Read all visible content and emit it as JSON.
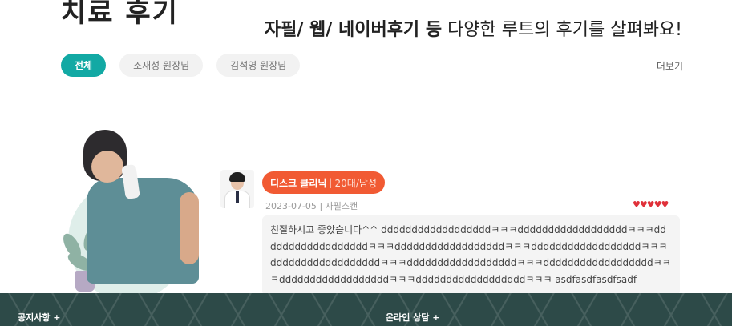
{
  "header": {
    "heading": "치료 후기",
    "subtitle_bold": "자필/ 웹/ 네이버후기 등",
    "subtitle_rest": " 다양한 루트의 후기를 살펴봐요!"
  },
  "tabs": [
    {
      "label": "전체",
      "active": true
    },
    {
      "label": "조재성 원장님",
      "active": false
    },
    {
      "label": "김석영 원장님",
      "active": false
    }
  ],
  "more_label": "더보기",
  "review": {
    "clinic": "디스크 클리닉",
    "separator": "|",
    "patient_meta": "20대/남성",
    "date": "2023-07-05",
    "date_separator": "|",
    "source": "자필스캔",
    "rating_display": "♥♥♥♥♥",
    "rating": 5,
    "text": "친절하시고 좋았습니다^^ ddddddddddddddddddㅋㅋㅋddddddddddddddddddㅋㅋㅋddddddddddddddddddㅋㅋㅋddddddddddddddddddㅋㅋㅋddddddddddddddddddㅋㅋㅋddddddddddddddddddㅋㅋㅋddddddddddddddddddㅋㅋㅋddddddddddddddddddㅋㅋㅋddddddddddddddddddㅋㅋㅋddddddddddddddddddㅋㅋㅋ asdfasdfasdfsadf"
  },
  "footer": {
    "notice_label": "공지사항 +",
    "consult_label": "온라인 상담 +"
  },
  "colors": {
    "accent_teal": "#12a9a4",
    "badge_orange": "#f15a33",
    "heart_red": "#e0313a",
    "footer_bg": "#2d4a48"
  }
}
